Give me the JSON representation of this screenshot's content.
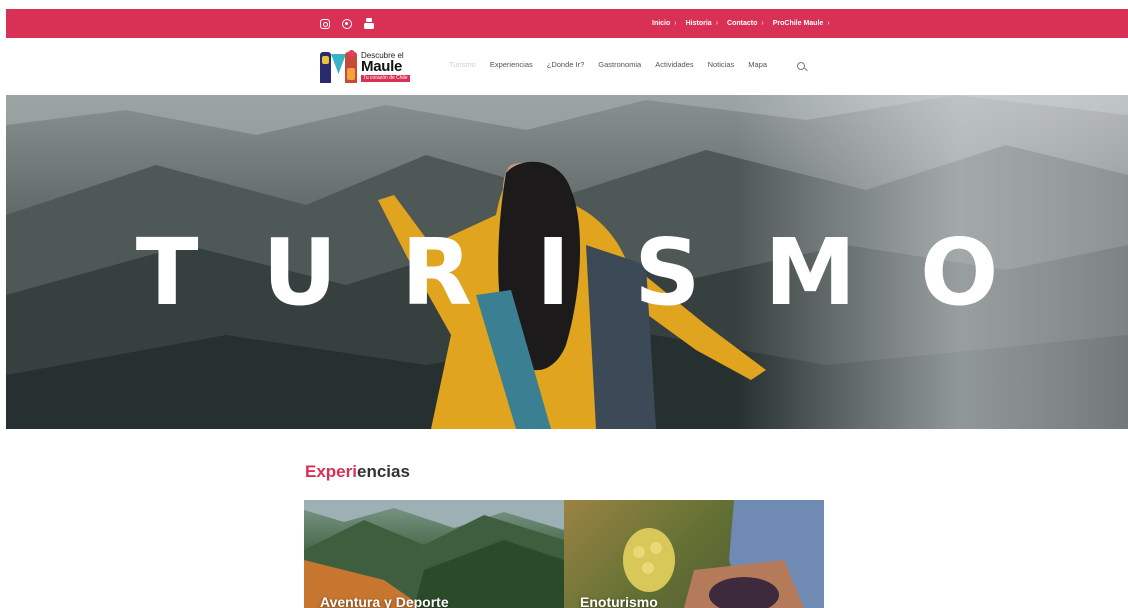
{
  "topbar": {
    "bg_color": "#d93055",
    "social_icons": [
      "instagram-icon",
      "tripadvisor-icon",
      "youtube-icon"
    ],
    "links": [
      {
        "label": "Inicio",
        "caret": "›"
      },
      {
        "label": "Historia",
        "caret": "›"
      },
      {
        "label": "Contacto",
        "caret": "›"
      },
      {
        "label": "ProChile Maule",
        "caret": "›"
      }
    ]
  },
  "logo": {
    "line1": "Descubre el",
    "line2": "Maule",
    "tag": "Tu corazón de Chile"
  },
  "nav": {
    "items": [
      {
        "label": "Turismo",
        "active": true
      },
      {
        "label": "Experiencias"
      },
      {
        "label": "¿Donde Ir?"
      },
      {
        "label": "Gastronomia"
      },
      {
        "label": "Actividades"
      },
      {
        "label": "Noticias"
      },
      {
        "label": "Mapa"
      }
    ],
    "search_icon": "search-icon"
  },
  "hero": {
    "title": "TURISMO"
  },
  "experiences": {
    "title_accent": "Experi",
    "title_rest": "encias",
    "accent_color": "#d93055",
    "cards": [
      {
        "label": "Aventura y Deporte"
      },
      {
        "label": "Enoturismo"
      }
    ]
  }
}
